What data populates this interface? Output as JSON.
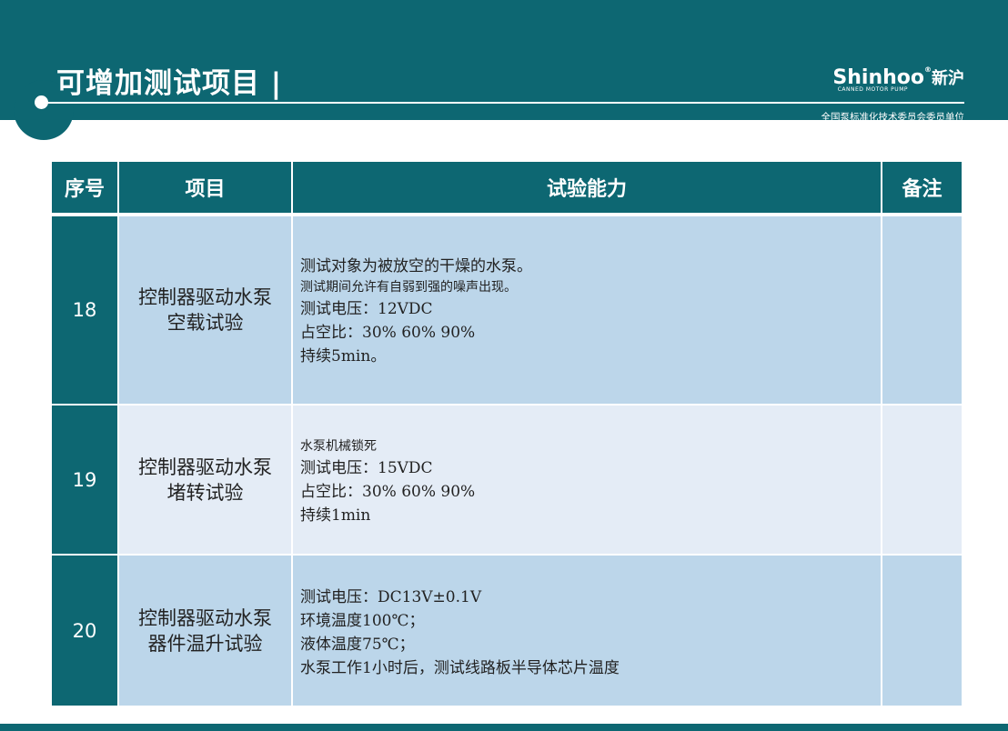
{
  "header": {
    "title": "可增加测试项目 |",
    "brand_name": "Shinhoo",
    "brand_reg": "®",
    "brand_cn": "新沪",
    "brand_sub": "CANNED MOTOR PUMP",
    "brand_unit": "全国泵标准化技术委员会委员单位"
  },
  "table": {
    "headers": [
      "序号",
      "项目",
      "试验能力",
      "备注"
    ],
    "rows": [
      {
        "no": "18",
        "item": [
          "控制器驱动水泵",
          "空载试验"
        ],
        "capability": [
          "测试对象为被放空的干燥的水泵。",
          "测试期间允许有自弱到强的噪声出现。",
          "测试电压：12VDC",
          "占空比：30% 60% 90%",
          "持续5min。"
        ],
        "remark": ""
      },
      {
        "no": "19",
        "item": [
          "控制器驱动水泵",
          "堵转试验"
        ],
        "capability": [
          "水泵机械锁死",
          "测试电压：15VDC",
          "占空比：30% 60% 90%",
          "持续1min"
        ],
        "remark": ""
      },
      {
        "no": "20",
        "item": [
          "控制器驱动水泵",
          "器件温升试验"
        ],
        "capability": [
          "测试电压：DC13V±0.1V",
          "环境温度100℃；",
          "液体温度75℃；",
          "水泵工作1小时后，测试线路板半导体芯片温度"
        ],
        "remark": ""
      }
    ]
  },
  "colors": {
    "brand_teal": "#0d6772",
    "row_blue": "#bcd6ea",
    "row_pale": "#e4ecf6"
  }
}
